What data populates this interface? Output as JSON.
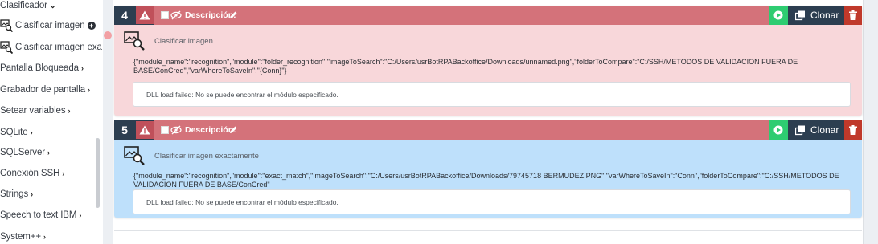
{
  "sidebar": {
    "items": [
      {
        "label": "Clasificador",
        "chevron": "v"
      },
      {
        "label": "Clasificar imagen",
        "sub": true,
        "plus": true
      },
      {
        "label": "Clasificar imagen exa",
        "sub": true
      },
      {
        "label": "Pantalla Bloqueada",
        "chevron": ">"
      },
      {
        "label": "Grabador de pantalla",
        "chevron": ">"
      },
      {
        "label": "Setear variables",
        "chevron": ">"
      },
      {
        "label": "SQLite",
        "chevron": ">"
      },
      {
        "label": "SQLServer",
        "chevron": ">"
      },
      {
        "label": "Conexión SSH",
        "chevron": ">"
      },
      {
        "label": "Strings",
        "chevron": ">"
      },
      {
        "label": "Speech to text IBM",
        "chevron": ">"
      },
      {
        "label": "System++",
        "chevron": ">"
      }
    ]
  },
  "cards": [
    {
      "number": "4",
      "description_label": "Descripción:",
      "clone_label": "Clonar",
      "title": "Clasificar imagen",
      "code": "{\"module_name\":\"recognition\",\"module\":\"folder_recognition\",\"imageToSearch\":\"C:/Users/usrBotRPABackoffice/Downloads/unnamed.png\",\"folderToCompare\":\"C:/SSH/METODOS DE VALIDACION FUERA DE BASE/ConCred\",\"varWhereToSaveIn\":\"{Conn}\"}",
      "error": "DLL load failed: No se puede encontrar el módulo especificado.",
      "body_color": "#f8d7da"
    },
    {
      "number": "5",
      "description_label": "Descripción:",
      "clone_label": "Clonar",
      "title": "Clasificar imagen exactamente",
      "code": "{\"module_name\":\"recognition\",\"module\":\"exact_match\",\"imageToSearch\":\"C:/Users/usrBotRPABackoffice/Downloads/79745718 BERMUDEZ.PNG\",\"varWhereToSaveIn\":\"Conn\",\"folderToCompare\":\"C:/SSH/METODOS DE VALIDACION FUERA DE BASE/ConCred\"",
      "error": "DLL load failed: No se puede encontrar el módulo especificado.",
      "body_color": "#bee0fb"
    }
  ],
  "colors": {
    "header": "#d4727a",
    "number_bg": "#2c3e50",
    "play": "#2ecc71",
    "clone": "#2c3e50",
    "delete": "#c0392b"
  },
  "icons": {
    "warning": "warning-icon",
    "eye_slash": "eye-slash-icon",
    "pencil": "pencil-icon",
    "play": "play-icon",
    "clone": "clone-icon",
    "trash": "trash-icon",
    "image_search": "image-search-icon"
  }
}
